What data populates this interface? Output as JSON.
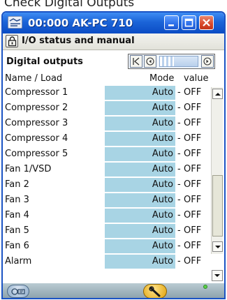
{
  "caption": "Check Digital Outputs",
  "window": {
    "title": "00:000 AK-PC 710",
    "buttons": {
      "minimize_icon": "minimize-icon",
      "maximize_icon": "maximize-icon",
      "close_icon": "close-icon"
    }
  },
  "toolbar": {
    "lock_icon": "lock-icon",
    "section_title": "I/O status and manual"
  },
  "subheader": {
    "title": "Digital outputs",
    "pager": {
      "first_icon": "first-page-icon",
      "prev_icon": "previous-icon",
      "next_icon": "next-icon"
    }
  },
  "table": {
    "columns": {
      "name": "Name / Load",
      "mode": "Mode",
      "value": "value"
    },
    "rows": [
      {
        "name": "Compressor 1",
        "mode": "Auto",
        "sep": "-",
        "value": "OFF"
      },
      {
        "name": "Compressor 2",
        "mode": "Auto",
        "sep": "-",
        "value": "OFF"
      },
      {
        "name": "Compressor 3",
        "mode": "Auto",
        "sep": "-",
        "value": "OFF"
      },
      {
        "name": "Compressor 4",
        "mode": "Auto",
        "sep": "-",
        "value": "OFF"
      },
      {
        "name": "Compressor 5",
        "mode": "Auto",
        "sep": "-",
        "value": "OFF"
      },
      {
        "name": "Fan 1/VSD",
        "mode": "Auto",
        "sep": "-",
        "value": "OFF"
      },
      {
        "name": "Fan 2",
        "mode": "Auto",
        "sep": "-",
        "value": "OFF"
      },
      {
        "name": "Fan 3",
        "mode": "Auto",
        "sep": "-",
        "value": "OFF"
      },
      {
        "name": "Fan 4",
        "mode": "Auto",
        "sep": "-",
        "value": "OFF"
      },
      {
        "name": "Fan 5",
        "mode": "Auto",
        "sep": "-",
        "value": "OFF"
      },
      {
        "name": "Fan 6",
        "mode": "Auto",
        "sep": "-",
        "value": "OFF"
      },
      {
        "name": "Alarm",
        "mode": "Auto",
        "sep": "-",
        "value": "OFF"
      }
    ]
  },
  "footer": {
    "left_icon": "service-tool-icon",
    "wrench_icon": "wrench-icon",
    "status": "status-led"
  },
  "colors": {
    "titlebar": "#1b64d8",
    "mode_cell": "#a8d4e4",
    "footer": "#9fb3bc",
    "led": "#5bd148"
  }
}
